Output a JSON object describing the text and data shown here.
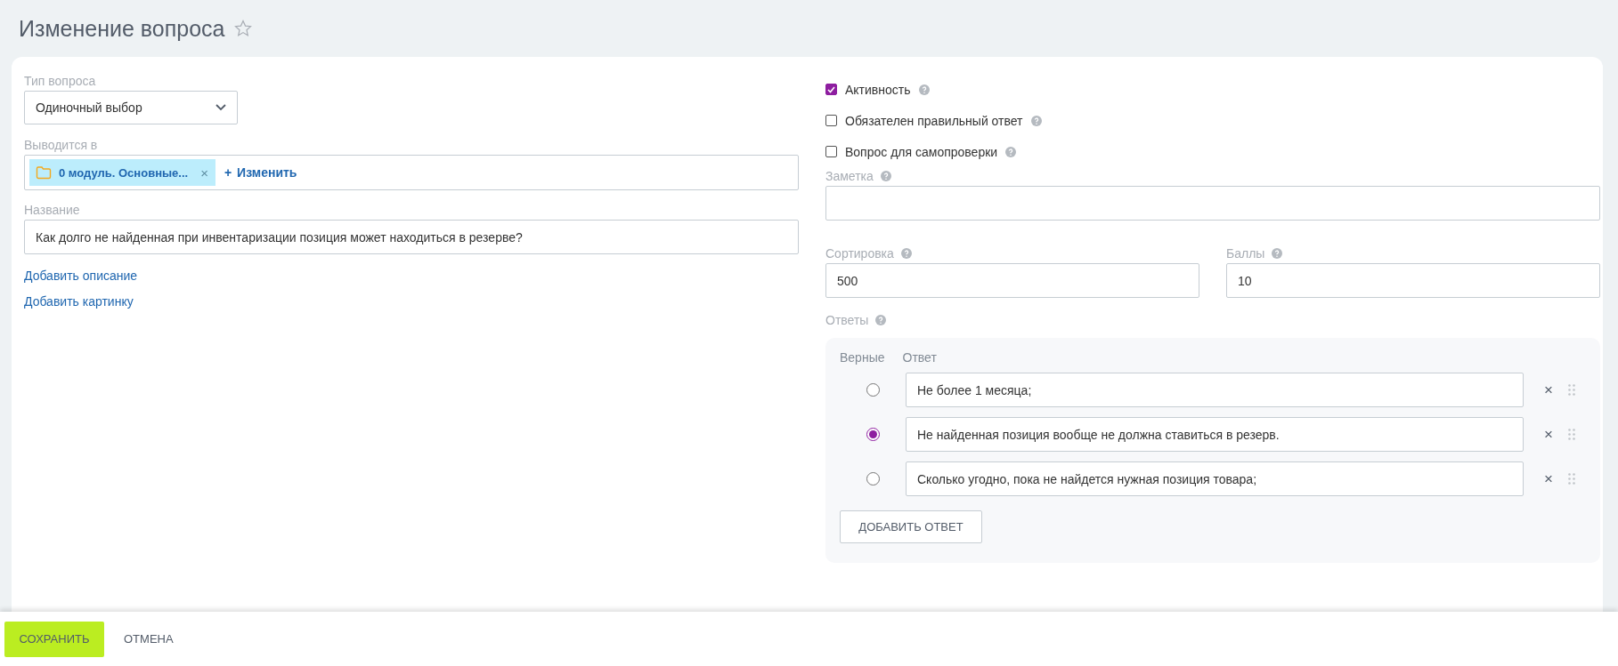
{
  "page": {
    "title": "Изменение вопроса",
    "favorite": false
  },
  "question_type": {
    "label": "Тип вопроса",
    "value": "Одиночный выбор"
  },
  "shown_in": {
    "label": "Выводится в",
    "tags": [
      {
        "label": "0 модуль. Основные...",
        "remove": "×"
      }
    ],
    "change_link": "Изменить",
    "plus": "+"
  },
  "name": {
    "label": "Название",
    "value": "Как долго не найденная при инвентаризации позиция может находиться в резерве?"
  },
  "links": [
    "Добавить описание",
    "Добавить картинку"
  ],
  "options": [
    {
      "label": "Активность",
      "checked": true
    },
    {
      "label": "Обязателен правильный ответ",
      "checked": false
    },
    {
      "label": "Вопрос для самопроверки",
      "checked": false
    }
  ],
  "note": {
    "label": "Заметка"
  },
  "sort": {
    "label": "Сортировка",
    "value": "500"
  },
  "points": {
    "label": "Баллы",
    "value": "10"
  },
  "answers": {
    "label": "Ответы",
    "columns": [
      "Верные",
      "Ответ"
    ],
    "rows": [
      {
        "text": "Не более 1 месяца;",
        "selected": false,
        "remove": "×"
      },
      {
        "text": "Не найденная позиция вообще не должна ставиться в резерв.",
        "selected": true,
        "remove": "×"
      },
      {
        "text": "Сколько угодно, пока не найдется нужная позиция товара;",
        "selected": false,
        "remove": "×"
      }
    ],
    "add_button": "ДОБАВИТЬ ОТВЕТ"
  },
  "footer": {
    "save": "СОХРАНИТЬ",
    "cancel": "ОТМЕНА"
  }
}
